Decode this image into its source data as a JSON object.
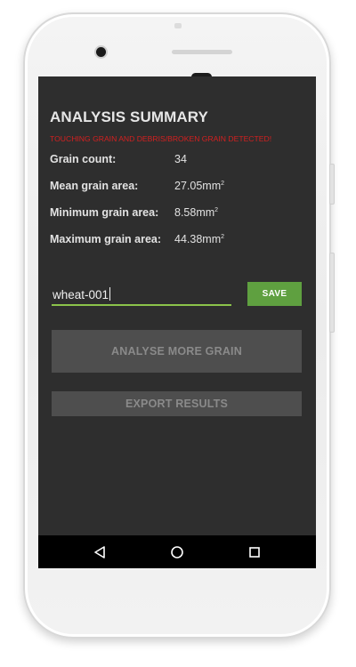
{
  "summary": {
    "title": "ANALYSIS SUMMARY",
    "warning": "TOUCHING GRAIN AND DEBRIS/BROKEN GRAIN DETECTED!",
    "rows": [
      {
        "label": "Grain count:",
        "value": "34",
        "unit": ""
      },
      {
        "label": "Mean grain area:",
        "value": "27.05mm",
        "unit": "2"
      },
      {
        "label": "Minimum grain area:",
        "value": "8.58mm",
        "unit": "2"
      },
      {
        "label": "Maximum grain area:",
        "value": "44.38mm",
        "unit": "2"
      }
    ]
  },
  "save_form": {
    "name_value": "wheat-001",
    "save_label": "SAVE"
  },
  "actions": {
    "analyse_label": "ANALYSE MORE GRAIN",
    "export_label": "EXPORT RESULTS"
  },
  "nav": {
    "back_icon": "back-triangle-icon",
    "home_icon": "home-circle-icon",
    "recent_icon": "recent-apps-square-icon"
  },
  "colors": {
    "screen_bg": "#2e2e2e",
    "warning": "#d32020",
    "accent_green": "#5fa040",
    "input_underline": "#8bc34a",
    "disabled_button": "#4e4e4e"
  }
}
